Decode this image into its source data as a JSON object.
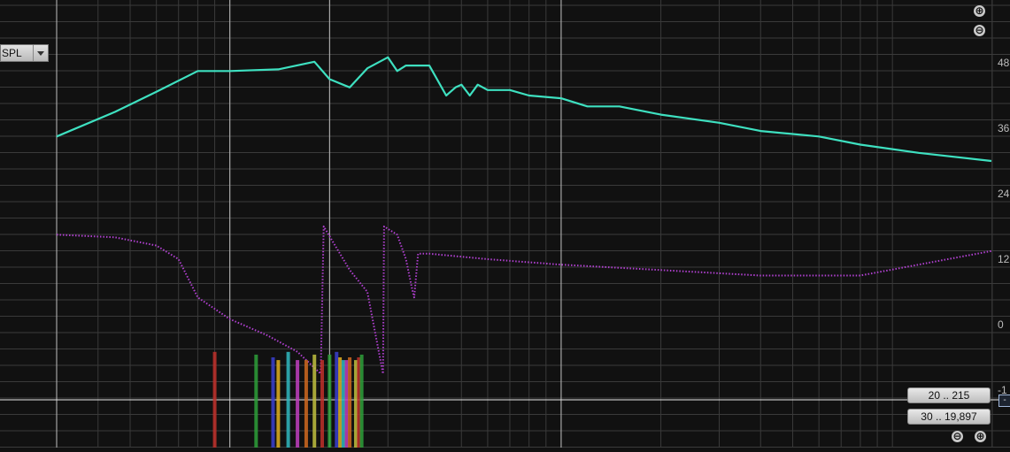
{
  "toolbar": {
    "trace_select": "SPL",
    "zoom_in": "⊕",
    "zoom_out": "⊖"
  },
  "ranges": {
    "y_range": "20 .. 215",
    "x_range": "30 .. 19,897"
  },
  "cursor_box": "-",
  "colors": {
    "background": "#111111",
    "grid": "#3a3a3a",
    "major_grid": "#bfbfbf",
    "spl": "#3ee0c0",
    "phase": "#b040d0"
  },
  "chart_data": {
    "type": "line",
    "x_scale": "log",
    "x_range_hz": [
      30,
      19897
    ],
    "y_ticks": [
      "48",
      "36",
      "24",
      "12",
      "0",
      "-1"
    ],
    "grid": true,
    "series": [
      {
        "style": "solid",
        "color": "#3ee0c0",
        "x": [
          30,
          45,
          60,
          80,
          100,
          140,
          180,
          200,
          230,
          260,
          300,
          320,
          340,
          360,
          400,
          450,
          480,
          500,
          530,
          560,
          600,
          700,
          800,
          1000,
          1200,
          1500,
          2000,
          3000,
          4000,
          6000,
          8000,
          12000,
          19897
        ],
        "y": [
          34.5,
          39,
          42.7,
          46.5,
          46.5,
          46.8,
          48.2,
          45,
          43.5,
          47,
          49,
          46.5,
          47.5,
          47.5,
          47.5,
          42,
          43.5,
          44,
          42,
          44,
          43,
          43,
          42,
          41.5,
          40,
          40,
          38.5,
          37,
          35.5,
          34.5,
          33,
          31.5,
          30
        ]
      },
      {
        "style": "dotted",
        "color": "#b040d0",
        "x": [
          30,
          45,
          60,
          70,
          80,
          100,
          130,
          160,
          188,
          192,
          230,
          260,
          290,
          292,
          320,
          340,
          355,
          360,
          370,
          400,
          600,
          1000,
          2000,
          4000,
          8000,
          19897
        ],
        "y": [
          16.5,
          16,
          14.5,
          12,
          5,
          1,
          -2,
          -5,
          -9,
          18,
          10,
          6,
          -9,
          18,
          16.5,
          12,
          6.5,
          5,
          13,
          13,
          12,
          11,
          10,
          9,
          9,
          13.5
        ]
      },
      {
        "style": "bars",
        "x": [
          90,
          120,
          135,
          140,
          150,
          160,
          170,
          180,
          190,
          200,
          210,
          215,
          220,
          225,
          230,
          240,
          245,
          250
        ],
        "y": [
          -5,
          -5.5,
          -6,
          -6.5,
          -5,
          -6.5,
          -6.5,
          -5.5,
          -6.5,
          -5.5,
          -5,
          -6,
          -6.5,
          -6.5,
          -6,
          -6.5,
          -6,
          -5.5
        ]
      }
    ]
  }
}
